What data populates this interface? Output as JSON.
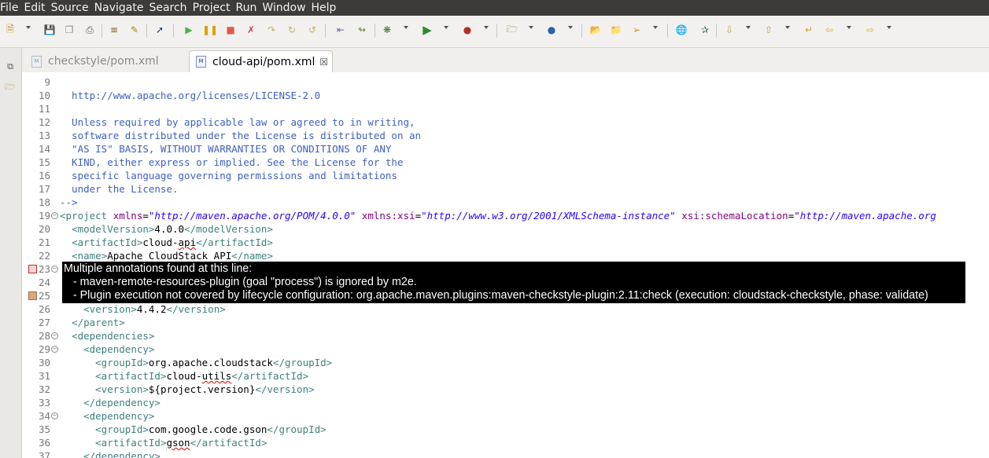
{
  "menubar": {
    "items": [
      "File",
      "Edit",
      "Source",
      "Navigate",
      "Search",
      "Project",
      "Run",
      "Window",
      "Help"
    ]
  },
  "toolbar": {
    "icons": [
      "new-icon",
      "save-icon",
      "save-all-icon",
      "print-icon",
      "toggle-breadcrumb-icon",
      "mark-occurrences-icon",
      "skip-breakpoints-icon",
      "resume-icon",
      "suspend-icon",
      "terminate-icon",
      "disconnect-icon",
      "step-into-icon",
      "step-over-icon",
      "step-return-icon",
      "drop-to-frame-icon",
      "use-step-filters-icon",
      "debug-icon",
      "run-icon",
      "run-last-tool-icon",
      "new-java-project-icon",
      "new-class-icon",
      "open-type-icon",
      "open-task-icon",
      "search-icon",
      "globe-icon",
      "open-perspective-icon",
      "next-annotation-icon",
      "previous-annotation-icon",
      "last-edit-icon",
      "back-icon",
      "forward-icon"
    ]
  },
  "tabs": [
    {
      "label": "checkstyle/pom.xml",
      "active": false,
      "icon": "M"
    },
    {
      "label": "cloud-api/pom.xml",
      "active": true,
      "icon": "M",
      "close": "☒"
    }
  ],
  "editor": {
    "colors": {
      "comment": "#3f5fbf",
      "tag": "#3f7f7f",
      "attribute": "#7f007f",
      "string": "#2a00ff",
      "text": "#000000"
    },
    "lines": [
      {
        "num": "9",
        "fold": "",
        "segs": [
          {
            "t": "",
            "c": "comment"
          }
        ]
      },
      {
        "num": "10",
        "fold": "",
        "segs": [
          {
            "t": "  http://www.apache.org/licenses/LICENSE-2.0",
            "c": "comment"
          }
        ]
      },
      {
        "num": "11",
        "fold": "",
        "segs": [
          {
            "t": "",
            "c": "comment"
          }
        ]
      },
      {
        "num": "12",
        "fold": "",
        "segs": [
          {
            "t": "  Unless required by applicable law or agreed to in writing,",
            "c": "comment"
          }
        ]
      },
      {
        "num": "13",
        "fold": "",
        "segs": [
          {
            "t": "  software distributed under the License is distributed on an",
            "c": "comment"
          }
        ]
      },
      {
        "num": "14",
        "fold": "",
        "segs": [
          {
            "t": "  \"AS IS\" BASIS, WITHOUT WARRANTIES OR CONDITIONS OF ANY",
            "c": "comment"
          }
        ]
      },
      {
        "num": "15",
        "fold": "",
        "segs": [
          {
            "t": "  KIND, either express or implied. See the License for the",
            "c": "comment"
          }
        ]
      },
      {
        "num": "16",
        "fold": "",
        "segs": [
          {
            "t": "  specific language governing permissions and limitations",
            "c": "comment"
          }
        ]
      },
      {
        "num": "17",
        "fold": "",
        "segs": [
          {
            "t": "  under the License.",
            "c": "comment"
          }
        ]
      },
      {
        "num": "18",
        "fold": "",
        "segs": [
          {
            "t": "-->",
            "c": "comment"
          }
        ]
      },
      {
        "num": "19",
        "fold": "−",
        "segs": [
          {
            "t": "<project ",
            "c": "tag"
          },
          {
            "t": "xmlns",
            "c": "attr"
          },
          {
            "t": "=",
            "c": "text"
          },
          {
            "t": "\"http://maven.apache.org/POM/4.0.0\"",
            "c": "str"
          },
          {
            "t": " ",
            "c": "text"
          },
          {
            "t": "xmlns:xsi",
            "c": "attr"
          },
          {
            "t": "=",
            "c": "text"
          },
          {
            "t": "\"http://www.w3.org/2001/XMLSchema-instance\"",
            "c": "str"
          },
          {
            "t": " ",
            "c": "text"
          },
          {
            "t": "xsi:schemaLocation",
            "c": "attr"
          },
          {
            "t": "=",
            "c": "text"
          },
          {
            "t": "\"http://maven.apache.org",
            "c": "str"
          }
        ]
      },
      {
        "num": "20",
        "fold": "",
        "segs": [
          {
            "t": "  ",
            "c": "text"
          },
          {
            "t": "<modelVersion>",
            "c": "tag"
          },
          {
            "t": "4.0.0",
            "c": "text"
          },
          {
            "t": "</modelVersion>",
            "c": "tag"
          }
        ]
      },
      {
        "num": "21",
        "fold": "",
        "segs": [
          {
            "t": "  ",
            "c": "text"
          },
          {
            "t": "<artifactId>",
            "c": "tag"
          },
          {
            "t": "cloud-",
            "c": "text"
          },
          {
            "t": "api",
            "c": "text",
            "sq": true
          },
          {
            "t": "</artifactId>",
            "c": "tag"
          }
        ]
      },
      {
        "num": "22",
        "fold": "",
        "segs": [
          {
            "t": "  ",
            "c": "text"
          },
          {
            "t": "<name>",
            "c": "tag"
          },
          {
            "t": "Apache CloudStack API",
            "c": "text"
          },
          {
            "t": "</name>",
            "c": "tag"
          }
        ]
      },
      {
        "num": "23",
        "fold": "−",
        "marker": "error",
        "segs": [
          {
            "t": "",
            "c": "text"
          }
        ]
      },
      {
        "num": "24",
        "fold": "",
        "segs": [
          {
            "t": "",
            "c": "text"
          }
        ]
      },
      {
        "num": "25",
        "fold": "",
        "marker": "warn",
        "segs": [
          {
            "t": "",
            "c": "text"
          }
        ]
      },
      {
        "num": "26",
        "fold": "",
        "segs": [
          {
            "t": "    ",
            "c": "text"
          },
          {
            "t": "<version>",
            "c": "tag"
          },
          {
            "t": "4.4.2",
            "c": "text"
          },
          {
            "t": "</version>",
            "c": "tag"
          }
        ]
      },
      {
        "num": "27",
        "fold": "",
        "segs": [
          {
            "t": "  ",
            "c": "text"
          },
          {
            "t": "</parent>",
            "c": "tag"
          }
        ]
      },
      {
        "num": "28",
        "fold": "−",
        "segs": [
          {
            "t": "  ",
            "c": "text"
          },
          {
            "t": "<dependencies>",
            "c": "tag"
          }
        ]
      },
      {
        "num": "29",
        "fold": "−",
        "segs": [
          {
            "t": "    ",
            "c": "text"
          },
          {
            "t": "<dependency>",
            "c": "tag"
          }
        ]
      },
      {
        "num": "30",
        "fold": "",
        "segs": [
          {
            "t": "      ",
            "c": "text"
          },
          {
            "t": "<groupId>",
            "c": "tag"
          },
          {
            "t": "org.apache.cloudstack",
            "c": "text"
          },
          {
            "t": "</groupId>",
            "c": "tag"
          }
        ]
      },
      {
        "num": "31",
        "fold": "",
        "segs": [
          {
            "t": "      ",
            "c": "text"
          },
          {
            "t": "<artifactId>",
            "c": "tag"
          },
          {
            "t": "cloud-",
            "c": "text"
          },
          {
            "t": "utils",
            "c": "text",
            "sq": true
          },
          {
            "t": "</artifactId>",
            "c": "tag"
          }
        ]
      },
      {
        "num": "32",
        "fold": "",
        "segs": [
          {
            "t": "      ",
            "c": "text"
          },
          {
            "t": "<version>",
            "c": "tag"
          },
          {
            "t": "${project.version}",
            "c": "text"
          },
          {
            "t": "</version>",
            "c": "tag"
          }
        ]
      },
      {
        "num": "33",
        "fold": "",
        "segs": [
          {
            "t": "    ",
            "c": "text"
          },
          {
            "t": "</dependency>",
            "c": "tag"
          }
        ]
      },
      {
        "num": "34",
        "fold": "−",
        "segs": [
          {
            "t": "    ",
            "c": "text"
          },
          {
            "t": "<dependency>",
            "c": "tag"
          }
        ]
      },
      {
        "num": "35",
        "fold": "",
        "segs": [
          {
            "t": "      ",
            "c": "text"
          },
          {
            "t": "<groupId>",
            "c": "tag"
          },
          {
            "t": "com.google.code.gson",
            "c": "text"
          },
          {
            "t": "</groupId>",
            "c": "tag"
          }
        ]
      },
      {
        "num": "36",
        "fold": "",
        "segs": [
          {
            "t": "      ",
            "c": "text"
          },
          {
            "t": "<artifactId>",
            "c": "tag"
          },
          {
            "t": "gson",
            "c": "text",
            "sq": true
          },
          {
            "t": "</artifactId>",
            "c": "tag"
          }
        ]
      },
      {
        "num": "37",
        "fold": "",
        "segs": [
          {
            "t": "    ",
            "c": "text"
          },
          {
            "t": "</dependency>",
            "c": "tag"
          }
        ]
      }
    ]
  },
  "tooltip": {
    "title": "Multiple annotations found at this line:",
    "lines": [
      "   - maven-remote-resources-plugin (goal \"process\") is ignored by m2e.",
      "   - Plugin execution not covered by lifecycle configuration: org.apache.maven.plugins:maven-checkstyle-plugin:2.11:check (execution: cloudstack-checkstyle, phase: validate)"
    ]
  }
}
